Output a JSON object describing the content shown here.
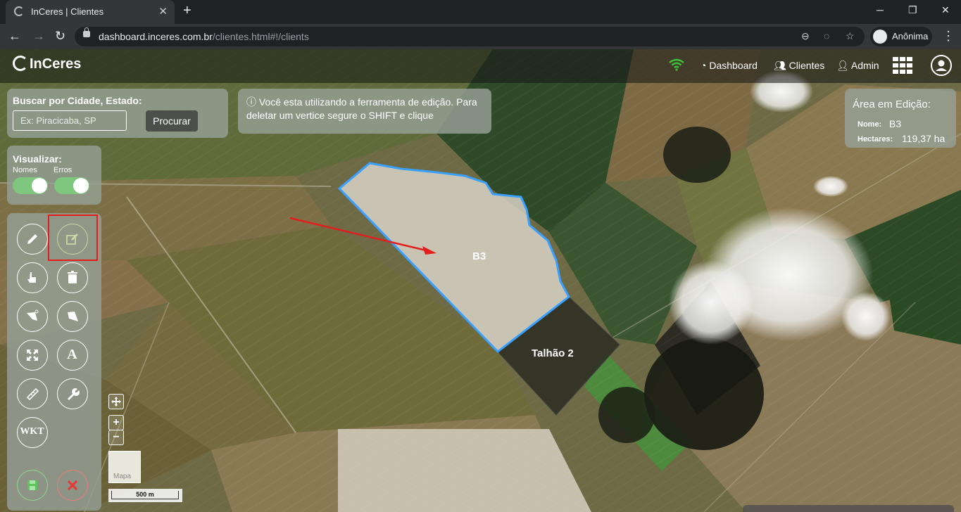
{
  "browser": {
    "tab_title": "InCeres | Clientes",
    "url_domain": "dashboard.inceres.com.br",
    "url_path": "/clientes.html#!/clients",
    "profile_label": "Anônima"
  },
  "app": {
    "logo_text": "InCeres",
    "nav": {
      "dashboard": "Dashboard",
      "clients": "Clientes",
      "admin": "Admin"
    }
  },
  "search": {
    "label": "Buscar por Cidade, Estado:",
    "placeholder": "Ex: Piracicaba, SP",
    "button": "Procurar"
  },
  "info": {
    "message": "Você esta utilizando a ferramenta de edição. Para deletar um vertice segure o SHIFT e clique"
  },
  "area_panel": {
    "title": "Área em Edição:",
    "name_label": "Nome:",
    "name_value": "B3",
    "hectares_label": "Hectares:",
    "hectares_value": "119,37 ha"
  },
  "visualize": {
    "title": "Visualizar:",
    "names_label": "Nomes",
    "errors_label": "Erros",
    "names_on": true,
    "errors_on": true
  },
  "tools": {
    "text_tool": "A",
    "wkt_tool": "WKT"
  },
  "map": {
    "polygon_selected": "B3",
    "polygon_other": "Talhão 2",
    "zoom_in": "+",
    "zoom_out": "−",
    "minimap_label": "Mapa",
    "scale_label": "500 m",
    "colors": {
      "accent_selection": "#3aa0ff",
      "annotation": "#e41e1e",
      "wifi": "#3bc43b"
    }
  }
}
